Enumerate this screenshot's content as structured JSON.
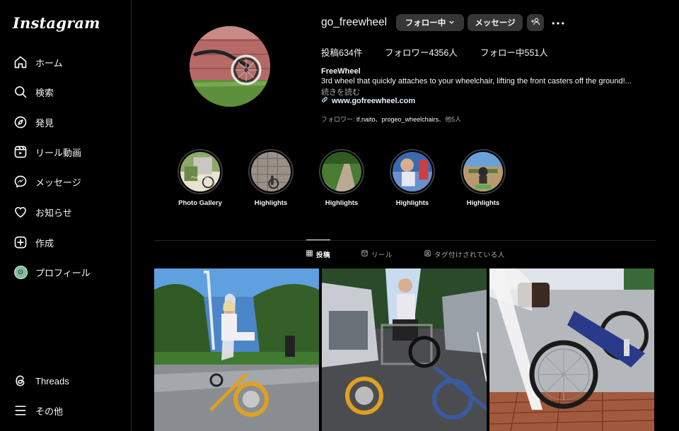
{
  "app": {
    "logo": "Instagram"
  },
  "sidebar": {
    "items": [
      {
        "label": "ホーム",
        "icon": "home-icon"
      },
      {
        "label": "検索",
        "icon": "search-icon"
      },
      {
        "label": "発見",
        "icon": "compass-icon"
      },
      {
        "label": "リール動画",
        "icon": "reels-icon"
      },
      {
        "label": "メッセージ",
        "icon": "messenger-icon"
      },
      {
        "label": "お知らせ",
        "icon": "heart-icon"
      },
      {
        "label": "作成",
        "icon": "create-icon"
      },
      {
        "label": "プロフィール",
        "icon": "profile-avatar"
      }
    ],
    "bottom": [
      {
        "label": "Threads",
        "icon": "threads-icon"
      },
      {
        "label": "その他",
        "icon": "menu-icon"
      }
    ]
  },
  "profile": {
    "username": "go_freewheel",
    "follow_button": "フォロー中",
    "message_button": "メッセージ",
    "stats": {
      "posts": "投稿634件",
      "followers": "フォロワー4356人",
      "following": "フォロー中551人"
    },
    "display_name": "FreeWheel",
    "bio": "3rd wheel that quickly attaches to your wheelchair, lifting the front casters off the ground!...",
    "more_link": "続きを読む",
    "website": "www.gofreewheel.com",
    "followed_by": {
      "prefix": "フォロワー: ",
      "names": "if.naito、progeo_wheelchairs",
      "suffix": "、他5人"
    }
  },
  "highlights": [
    {
      "label": "Photo Gallery"
    },
    {
      "label": "Highlights"
    },
    {
      "label": "Highlights"
    },
    {
      "label": "Highlights"
    },
    {
      "label": "Highlights"
    }
  ],
  "tabs": [
    {
      "label": "投稿",
      "active": true
    },
    {
      "label": "リール",
      "active": false
    },
    {
      "label": "タグ付けされている人",
      "active": false
    }
  ],
  "colors": {
    "background": "#000000",
    "button": "#363636",
    "link": "#e0f1ff",
    "secondary_text": "#a8a8a8",
    "divider": "#262626"
  }
}
